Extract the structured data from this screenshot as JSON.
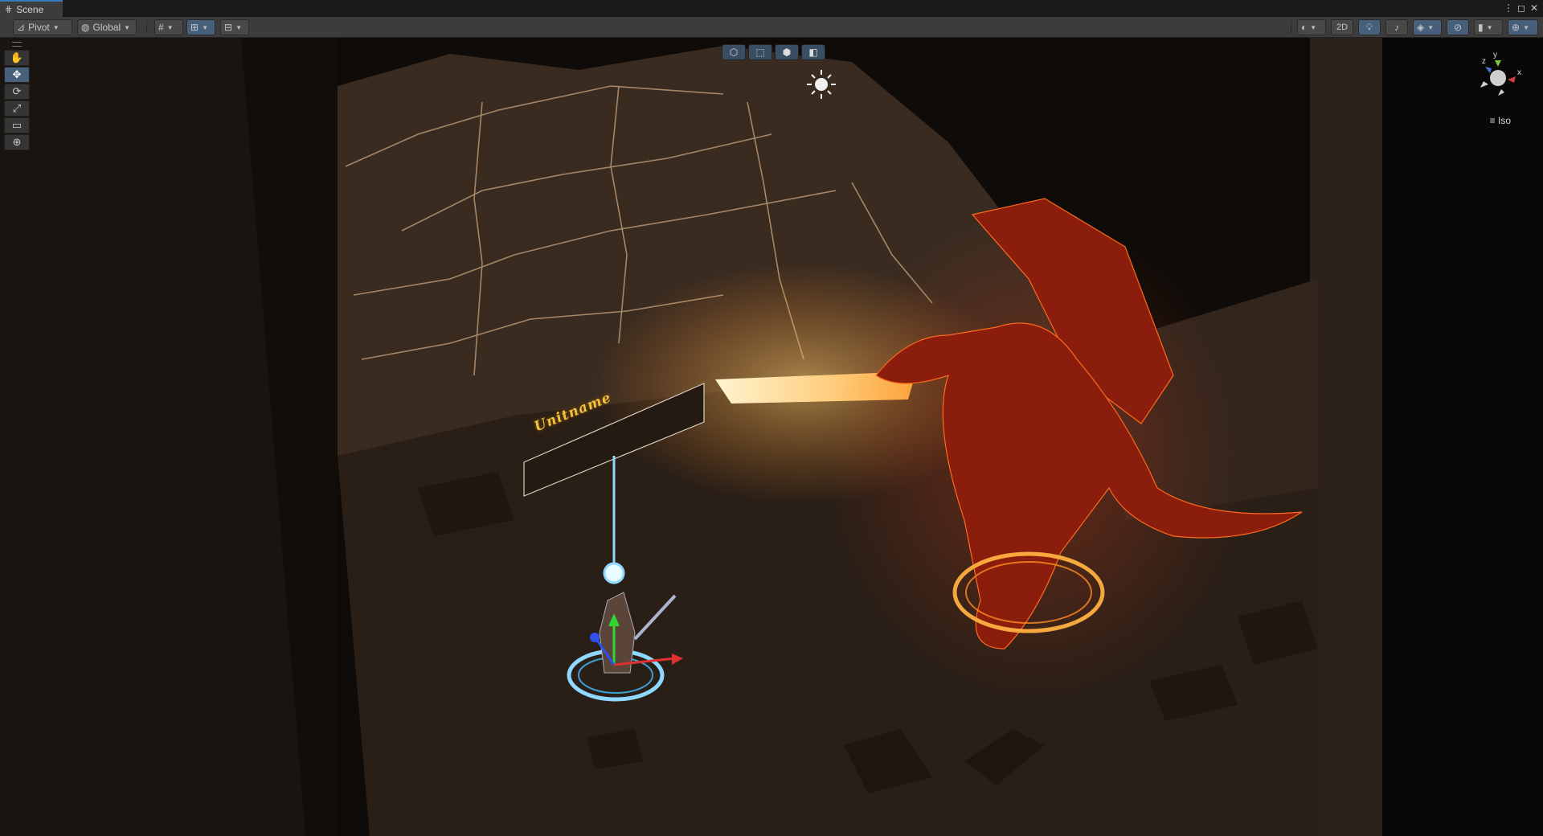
{
  "tab": {
    "title": "Scene"
  },
  "toolbar": {
    "pivot_label": "Pivot",
    "global_label": "Global",
    "mode_2d_label": "2D"
  },
  "tools": [
    {
      "name": "hand-tool",
      "glyph": "✋"
    },
    {
      "name": "move-tool",
      "glyph": "✥"
    },
    {
      "name": "rotate-tool",
      "glyph": "⟳"
    },
    {
      "name": "scale-tool",
      "glyph": "⤢"
    },
    {
      "name": "rect-tool",
      "glyph": "▭"
    },
    {
      "name": "transform-tool",
      "glyph": "⊕"
    }
  ],
  "gizmo": {
    "y_label": "y",
    "z_label": "z",
    "x_label": "x",
    "projection_label": "Iso"
  },
  "scene": {
    "unit_label": "Unitname"
  },
  "colors": {
    "accent": "#3a79bb",
    "toolbar_bg": "#3c3c3c",
    "active_tool": "#46607c",
    "flame": "#ffb040",
    "selection": "#8fd8ff"
  }
}
